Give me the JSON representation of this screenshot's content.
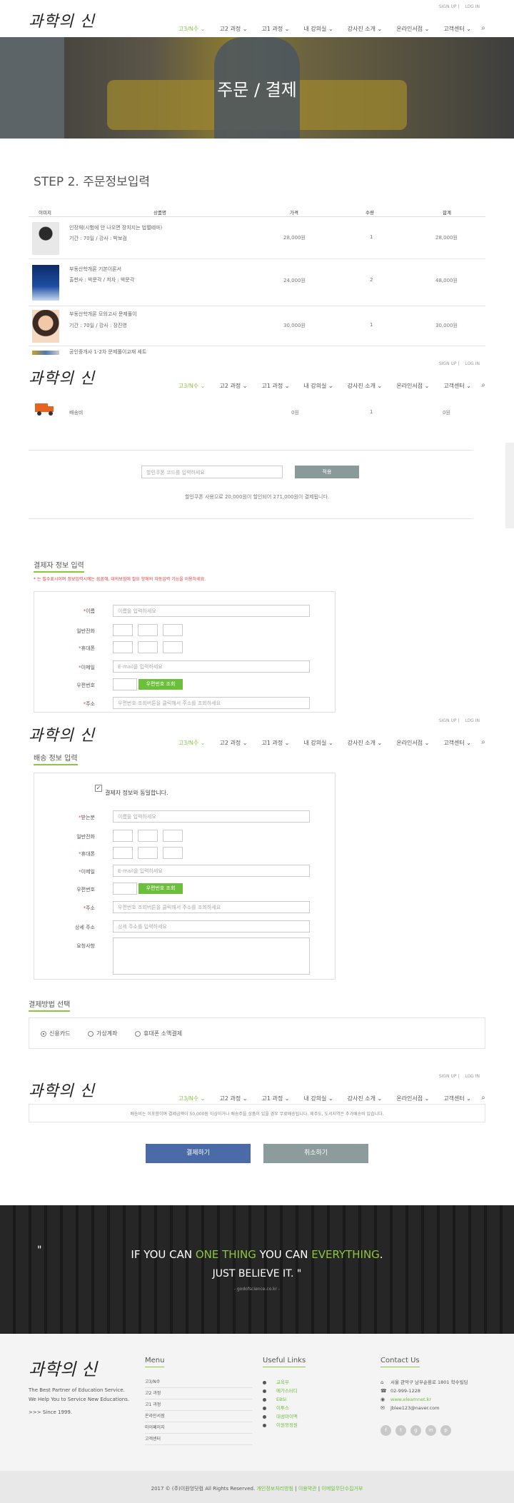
{
  "header": {
    "logo": "과학의 신",
    "logo_small": "의",
    "signup": "SIGN UP",
    "login": "LOG IN",
    "nav": [
      "고3/N수 ⌄",
      "고2 과정 ⌄",
      "고1 과정 ⌄",
      "내 강의실 ⌄",
      "강사진 소개 ⌄",
      "온라인서점 ⌄",
      "고객센터 ⌄"
    ],
    "search_icon": "search-icon"
  },
  "hero": {
    "title": "주문 / 결제"
  },
  "step_title": "STEP 2. 주문정보입력",
  "table": {
    "headers": [
      "이미지",
      "상품명",
      "가격",
      "수량",
      "합계"
    ],
    "rows": [
      {
        "name": "인장재(시험에 안 나오면 장치지는 법벌테마)",
        "meta": "기간 : 70일   /   강사 : 박보검",
        "price": "28,000원",
        "qty": "1",
        "sum": "28,000원"
      },
      {
        "name": "부동산학개론 기본이론서",
        "meta": "출판사 : 박문각   /   저자 : 박문각",
        "price": "24,000원",
        "qty": "2",
        "sum": "48,000원"
      },
      {
        "name": "부동산학개론 모의고사 문제풀이",
        "meta": "기간 : 70일   /   강사 : 장진영",
        "price": "30,000원",
        "qty": "1",
        "sum": "30,000원"
      },
      {
        "name": "공인중개사 1-2차 문제풀이교재 세트",
        "meta": "",
        "price": "",
        "qty": "",
        "sum": ""
      },
      {
        "name": "배송비",
        "meta": "",
        "price": "0원",
        "qty": "1",
        "sum": "0원"
      }
    ]
  },
  "coupon": {
    "placeholder": "할인쿠폰 코드를 입력하세요",
    "button": "적용",
    "note": "할인쿠폰 사용으로 20,000원이 할인되어 271,000원이 결제됩니다."
  },
  "payer": {
    "title": "결제자 정보 입력",
    "warning": "* 는 필수표시이며 정보입력시에는 꼼꼼해, 대의보험에 필요 항에의 자동입력 기능을 이용하세요.",
    "name_label": "이름",
    "name_ph": "이름을 입력하세요",
    "phone_label": "일반전화",
    "mobile_label": "휴대폰",
    "email_label": "이메일",
    "email_ph": "E-mail을 입력하세요",
    "zip_label": "우편번호",
    "zip_btn": "우편번호 조회",
    "addr_label": "주소",
    "addr_ph": "우편번호 조회버튼을 클릭해서 주소를 조회하세요"
  },
  "shipping": {
    "title": "배송 정보 입력",
    "same_check": "결제자 정보와 동일합니다.",
    "recv_label": "받는분",
    "recv_ph": "이름을 입력하세요",
    "phone_label": "일반전화",
    "mobile_label": "휴대폰",
    "email_label": "이메일",
    "email_ph": "E-mail을 입력하세요",
    "zip_label": "우편번호",
    "zip_btn": "우편번호 조회",
    "addr_label": "주소",
    "addr_ph": "우편번호 조회버튼을 클릭해서 주소를 조회하세요",
    "detail_label": "상세 주소",
    "detail_ph": "상세 주소를 입력하세요",
    "req_label": "요청사항"
  },
  "payment": {
    "title": "결제방법 선택",
    "options": [
      "신용카드",
      "가상계좌",
      "휴대폰 소액결제"
    ]
  },
  "notice": "배송비는 이포함이며 결제금액이 50,000원 이상이거나 배송주을 상품이 있을 경우 무료배송됩니다. 제주도, 도서지역은 추가배송비 있습니다.",
  "buttons": {
    "pay": "결제하기",
    "cancel": "취소하기"
  },
  "quote": {
    "mark": "\"",
    "p1": "IF YOU CAN ",
    "g1": "ONE THING",
    "p2": " YOU CAN ",
    "g2": "EVERYTHING",
    "p3": ".",
    "line2": "JUST BELIEVE IT. \"",
    "source": "- godofscience.co.kr -"
  },
  "footer": {
    "logo": "과학의 신",
    "desc1": "The Best Partner of Education Service.",
    "desc2": "We Help You to Service New Educations.",
    "desc3": ">>> Since 1999.",
    "menu_title": "Menu",
    "menu": [
      "고3/N수",
      "고2 과정",
      "고1 과정",
      "온라인서점",
      "마이페이지",
      "고객센터"
    ],
    "links_title": "Useful Links",
    "links": [
      "교육부",
      "메가스터디",
      "EBSi",
      "이투스",
      "대성마이맥",
      "이원엉정원"
    ],
    "contact_title": "Contact Us",
    "address": "서울 관악구 남부순환로 1801 학수빌딩",
    "phone": "02-999-1228",
    "web": "www.elearnnet.kr",
    "email": "jblee123@naver.com",
    "copyright": "2017 © (주)이원엉닷컴 All Rights Reserved.",
    "policy1": "개인정보처리방침",
    "policy2": "이용약관",
    "policy3": "이메일무단수집거부"
  }
}
